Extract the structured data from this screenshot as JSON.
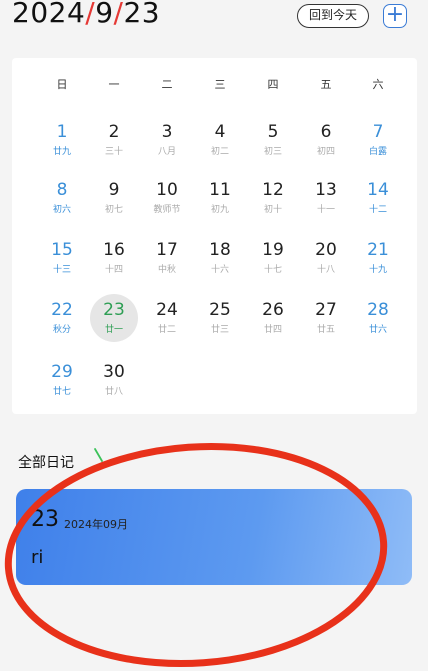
{
  "header": {
    "year": "2024",
    "sep1": "/",
    "month": "9",
    "sep2": "/",
    "day": "23",
    "today_button": "回到今天",
    "add_button": "+"
  },
  "weekdays": [
    "日",
    "一",
    "二",
    "三",
    "四",
    "五",
    "六"
  ],
  "days": [
    {
      "num": "1",
      "sub": "廿九",
      "weekend": true
    },
    {
      "num": "2",
      "sub": "三十"
    },
    {
      "num": "3",
      "sub": "八月"
    },
    {
      "num": "4",
      "sub": "初二"
    },
    {
      "num": "5",
      "sub": "初三"
    },
    {
      "num": "6",
      "sub": "初四"
    },
    {
      "num": "7",
      "sub": "白露",
      "weekend": true
    },
    {
      "num": "8",
      "sub": "初六",
      "weekend": true
    },
    {
      "num": "9",
      "sub": "初七"
    },
    {
      "num": "10",
      "sub": "教师节"
    },
    {
      "num": "11",
      "sub": "初九"
    },
    {
      "num": "12",
      "sub": "初十"
    },
    {
      "num": "13",
      "sub": "十一"
    },
    {
      "num": "14",
      "sub": "十二",
      "weekend": true
    },
    {
      "num": "15",
      "sub": "十三",
      "weekend": true
    },
    {
      "num": "16",
      "sub": "十四"
    },
    {
      "num": "17",
      "sub": "中秋"
    },
    {
      "num": "18",
      "sub": "十六"
    },
    {
      "num": "19",
      "sub": "十七"
    },
    {
      "num": "20",
      "sub": "十八"
    },
    {
      "num": "21",
      "sub": "十九",
      "weekend": true
    },
    {
      "num": "22",
      "sub": "秋分",
      "weekend": true
    },
    {
      "num": "23",
      "sub": "廿一",
      "selected": true
    },
    {
      "num": "24",
      "sub": "廿二"
    },
    {
      "num": "25",
      "sub": "廿三"
    },
    {
      "num": "26",
      "sub": "廿四"
    },
    {
      "num": "27",
      "sub": "廿五"
    },
    {
      "num": "28",
      "sub": "廿六",
      "weekend": true
    },
    {
      "num": "29",
      "sub": "廿七",
      "weekend": true
    },
    {
      "num": "30",
      "sub": "廿八"
    }
  ],
  "diary_section": {
    "title": "全部日记"
  },
  "diary_entry": {
    "day": "23",
    "month_label": "2024年09月",
    "content": "ri"
  },
  "colors": {
    "accent_blue": "#3a8fd8",
    "selected_green": "#2e9e54",
    "title_red": "#e53935",
    "annotation_red": "#e8311a"
  }
}
